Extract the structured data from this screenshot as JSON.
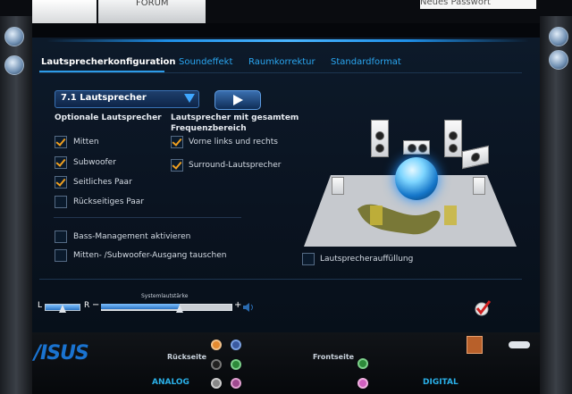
{
  "top": {
    "left_tab_caption": "FORUM",
    "right_tab_text": "Neues Passwort"
  },
  "tabs": [
    {
      "label": "Lautsprecherkonfiguration"
    },
    {
      "label": "Soundeffekt"
    },
    {
      "label": "Raumkorrektur"
    },
    {
      "label": "Standardformat"
    }
  ],
  "config": {
    "selected": "7.1 Lautsprecher"
  },
  "optional": {
    "heading": "Optionale Lautsprecher",
    "items": [
      {
        "label": "Mitten",
        "checked": true
      },
      {
        "label": "Subwoofer",
        "checked": true
      },
      {
        "label": "Seitliches Paar",
        "checked": true
      },
      {
        "label": "Rückseitiges Paar",
        "checked": false
      }
    ]
  },
  "fullrange": {
    "heading_line1": "Lautsprecher mit gesamtem",
    "heading_line2": "Frequenzbereich",
    "items": [
      {
        "label": "Vorne links und rechts",
        "checked": true
      },
      {
        "label": "Surround-Lautsprecher",
        "checked": true
      }
    ]
  },
  "options": [
    {
      "label": "Bass-Management aktivieren",
      "checked": false
    },
    {
      "label": "Mitten- /Subwoofer-Ausgang tauschen",
      "checked": false
    }
  ],
  "fill": {
    "label": "Lautsprecherauffüllung",
    "checked": false
  },
  "volume": {
    "caption": "Systemlautstärke",
    "left": "L",
    "right": "R",
    "minus": "−",
    "plus": "+",
    "level": 0.6,
    "balance": 0.5
  },
  "bottom": {
    "brand": "/ISUS",
    "rear_label": "Rückseite",
    "front_label": "Frontseite",
    "analog": "ANALOG",
    "digital": "DIGITAL"
  },
  "colors": {
    "accent": "#2d9be8",
    "check": "#f0a020",
    "brand": "#1a73d0"
  }
}
